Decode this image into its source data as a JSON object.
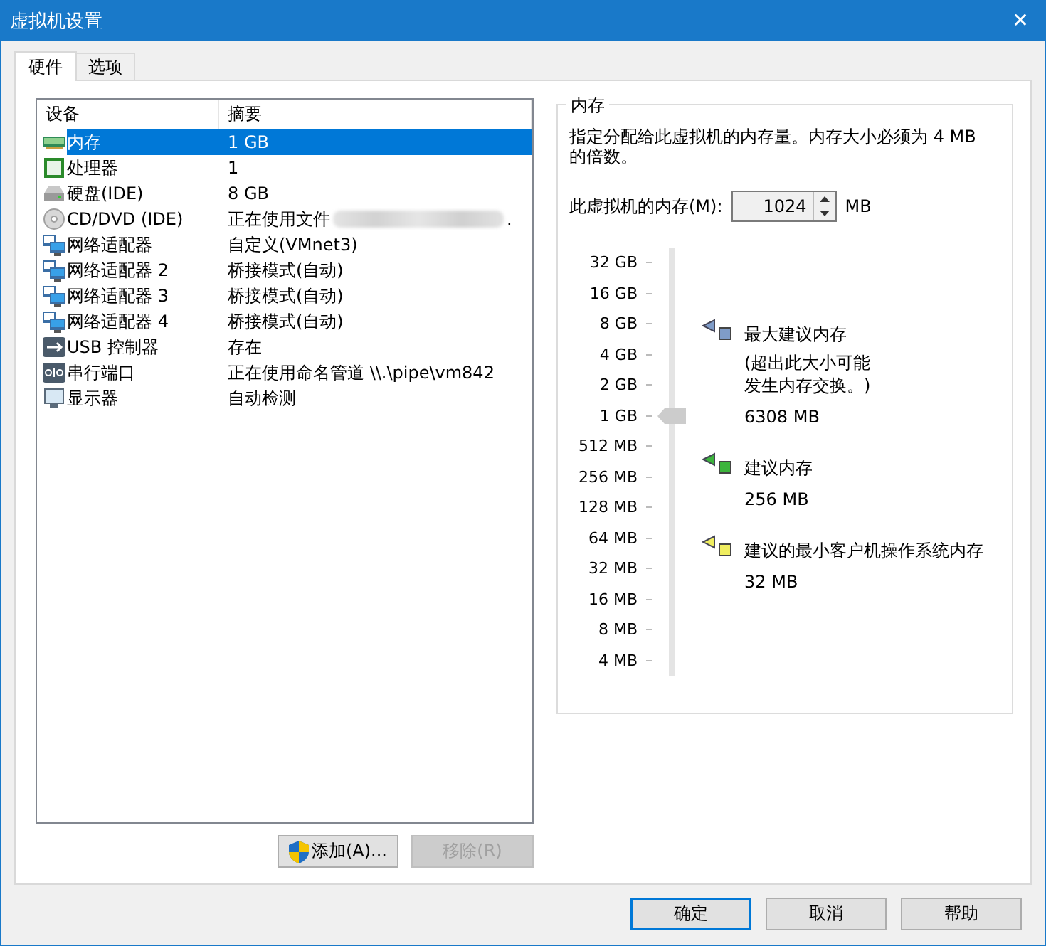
{
  "window": {
    "title": "虚拟机设置",
    "close_glyph": "✕"
  },
  "tabs": [
    {
      "label": "硬件",
      "selected": true
    },
    {
      "label": "选项",
      "selected": false
    }
  ],
  "devices": {
    "columns": [
      "设备",
      "摘要"
    ],
    "rows": [
      {
        "kind": "memory",
        "name": "内存",
        "summary": "1 GB",
        "selected": true,
        "redacted": false
      },
      {
        "kind": "cpu",
        "name": "处理器",
        "summary": "1",
        "selected": false,
        "redacted": false
      },
      {
        "kind": "disk",
        "name": "硬盘(IDE)",
        "summary": "8 GB",
        "selected": false,
        "redacted": false
      },
      {
        "kind": "cd",
        "name": "CD/DVD (IDE)",
        "summary": "正在使用文件",
        "summary_tail": ".",
        "selected": false,
        "redacted": true
      },
      {
        "kind": "network",
        "name": "网络适配器",
        "summary": "自定义(VMnet3)",
        "selected": false,
        "redacted": false
      },
      {
        "kind": "network",
        "name": "网络适配器 2",
        "summary": "桥接模式(自动)",
        "selected": false,
        "redacted": false
      },
      {
        "kind": "network",
        "name": "网络适配器 3",
        "summary": "桥接模式(自动)",
        "selected": false,
        "redacted": false
      },
      {
        "kind": "network",
        "name": "网络适配器 4",
        "summary": "桥接模式(自动)",
        "selected": false,
        "redacted": false
      },
      {
        "kind": "usb",
        "name": "USB 控制器",
        "summary": "存在",
        "selected": false,
        "redacted": false
      },
      {
        "kind": "serial",
        "name": "串行端口",
        "summary": "正在使用命名管道 \\\\.\\pipe\\vm842",
        "selected": false,
        "redacted": false
      },
      {
        "kind": "display",
        "name": "显示器",
        "summary": "自动检测",
        "selected": false,
        "redacted": false
      }
    ]
  },
  "device_buttons": [
    {
      "label": "添加(A)...",
      "shield": true,
      "disabled": false
    },
    {
      "label": "移除(R)",
      "shield": false,
      "disabled": true
    }
  ],
  "memory": {
    "title": "内存",
    "description": "指定分配给此虚拟机的内存量。内存大小必须为 4 MB 的倍数。",
    "field_label": "此虚拟机的内存(M):",
    "value": "1024",
    "unit": "MB",
    "scale": [
      "32 GB",
      "16 GB",
      "8 GB",
      "4 GB",
      "2 GB",
      "1 GB",
      "512 MB",
      "256 MB",
      "128 MB",
      "64 MB",
      "32 MB",
      "16 MB",
      "8 MB",
      "4 MB"
    ],
    "level": 0.615,
    "legend": [
      {
        "label": "最大建议内存",
        "note": "(超出此大小可能发生内存交换。)",
        "value": "6308 MB",
        "color": "#7f9cc8"
      },
      {
        "label": "建议内存",
        "value": "256 MB",
        "color": "#3cb43c"
      },
      {
        "label": "建议的最小客户机操作系统内存",
        "value": "32 MB",
        "color": "#f0ee60"
      }
    ]
  },
  "footer_buttons": [
    {
      "label": "确定",
      "default": true
    },
    {
      "label": "取消",
      "default": false
    },
    {
      "label": "帮助",
      "default": false
    }
  ]
}
